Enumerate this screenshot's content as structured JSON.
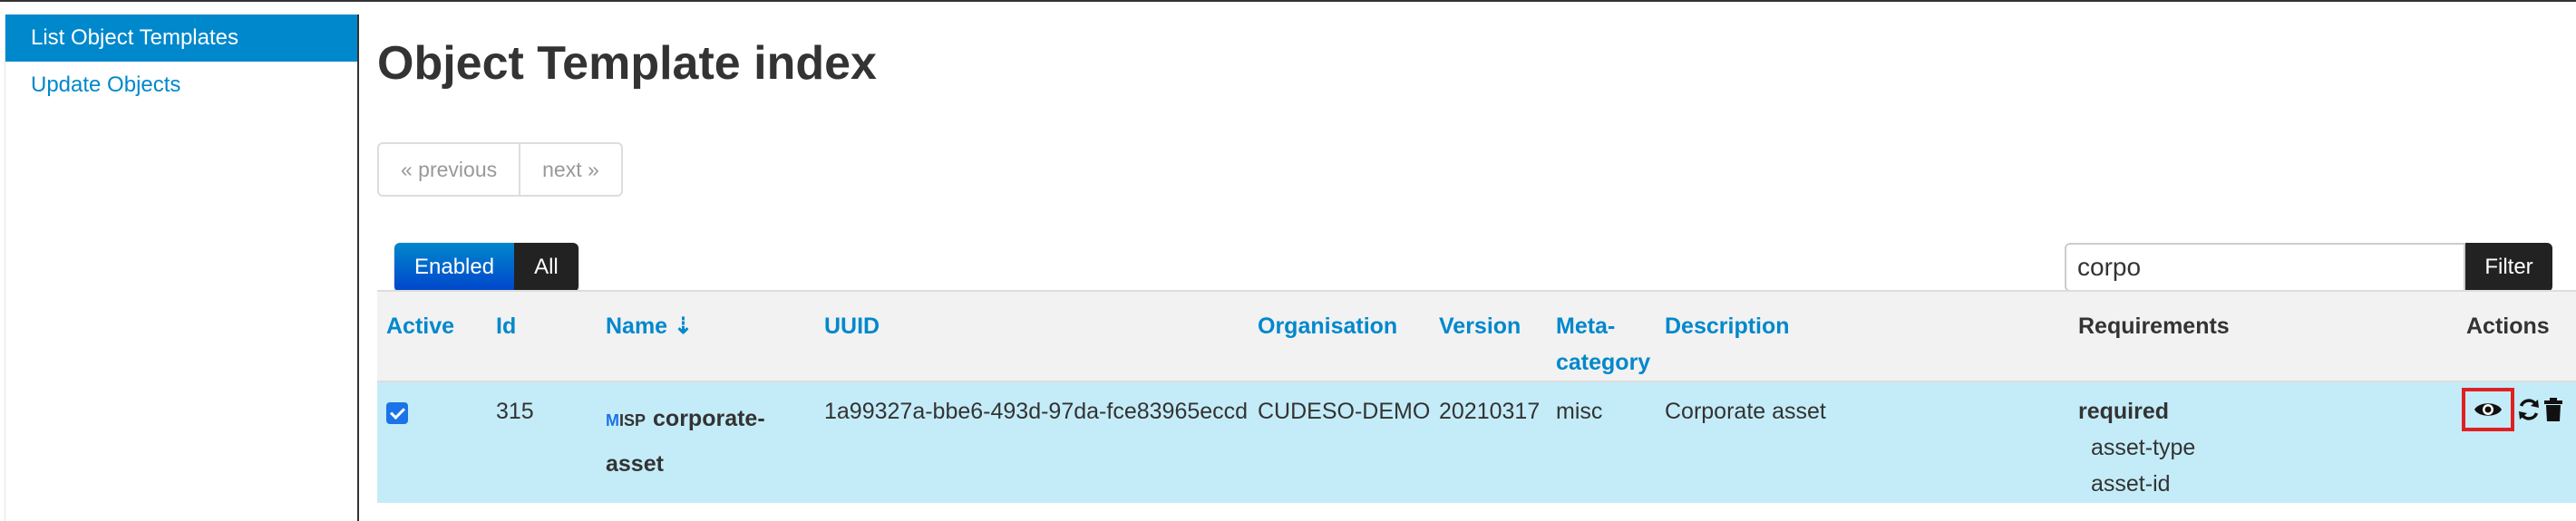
{
  "sidebar": {
    "items": [
      {
        "label": "List Object Templates",
        "active": true
      },
      {
        "label": "Update Objects",
        "active": false
      }
    ]
  },
  "page": {
    "title": "Object Template index"
  },
  "pagination": {
    "previous": "« previous",
    "next": "next »"
  },
  "toggle": {
    "enabled": "Enabled",
    "all": "All"
  },
  "filter": {
    "value": "corpo",
    "button": "Filter"
  },
  "table": {
    "headers": {
      "active": "Active",
      "id": "Id",
      "name": "Name ⇣",
      "uuid": "UUID",
      "organisation": "Organisation",
      "version": "Version",
      "meta_category_1": "Meta-",
      "meta_category_2": "category",
      "description": "Description",
      "requirements": "Requirements",
      "actions": "Actions"
    },
    "rows": [
      {
        "active": true,
        "id": "315",
        "logo_m": "M",
        "logo_rest": "ISP",
        "name_1": "corporate-",
        "name_2": "asset",
        "uuid": "1a99327a-bbe6-493d-97da-fce83965eccd",
        "organisation": "CUDESO-DEMO",
        "version": "20210317",
        "meta_category": "misc",
        "description": "Corporate asset",
        "requirements_title": "required",
        "requirements": [
          "asset-type",
          "asset-id"
        ]
      }
    ]
  },
  "colors": {
    "accent": "#0088cc",
    "row_highlight": "#c4ecf8",
    "highlight_box": "#e02020"
  },
  "icons": {
    "view": "eye-icon",
    "update": "refresh-icon",
    "delete": "trash-icon"
  }
}
